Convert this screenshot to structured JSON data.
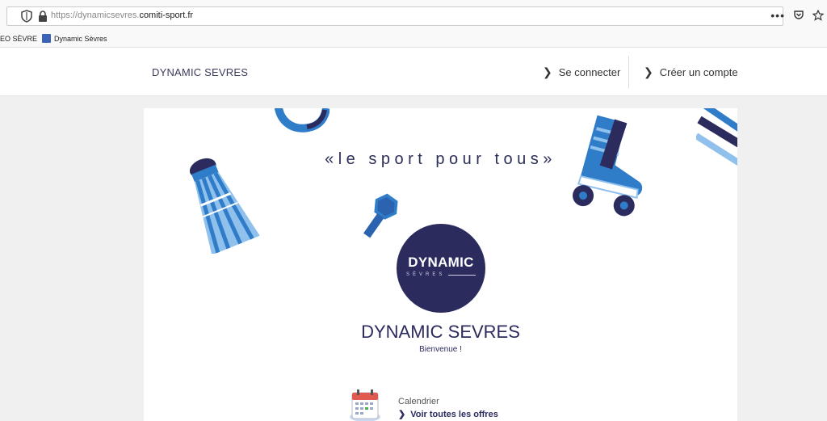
{
  "browser": {
    "url_prefix": "https://dynamicsevres.",
    "url_host": "comiti-sport.fr",
    "menu_dots": "•••",
    "bookmarks": [
      {
        "label": "EO SÈVRE"
      },
      {
        "label": "Dynamic Sèvres"
      }
    ]
  },
  "header": {
    "brand": "DYNAMIC SEVRES",
    "login_label": "Se connecter",
    "signup_label": "Créer un compte"
  },
  "hero": {
    "slogan": "«le sport pour tous»",
    "logo_text": "DYNAMIC",
    "logo_sub": "SÈVRES",
    "club_name": "DYNAMIC SEVRES",
    "welcome": "Bienvenue !"
  },
  "calendar": {
    "label": "Calendrier",
    "link": "Voir toutes les offres"
  },
  "colors": {
    "navy": "#2b2b5e",
    "blue": "#3b82c8",
    "light_blue": "#8fc1ec"
  }
}
